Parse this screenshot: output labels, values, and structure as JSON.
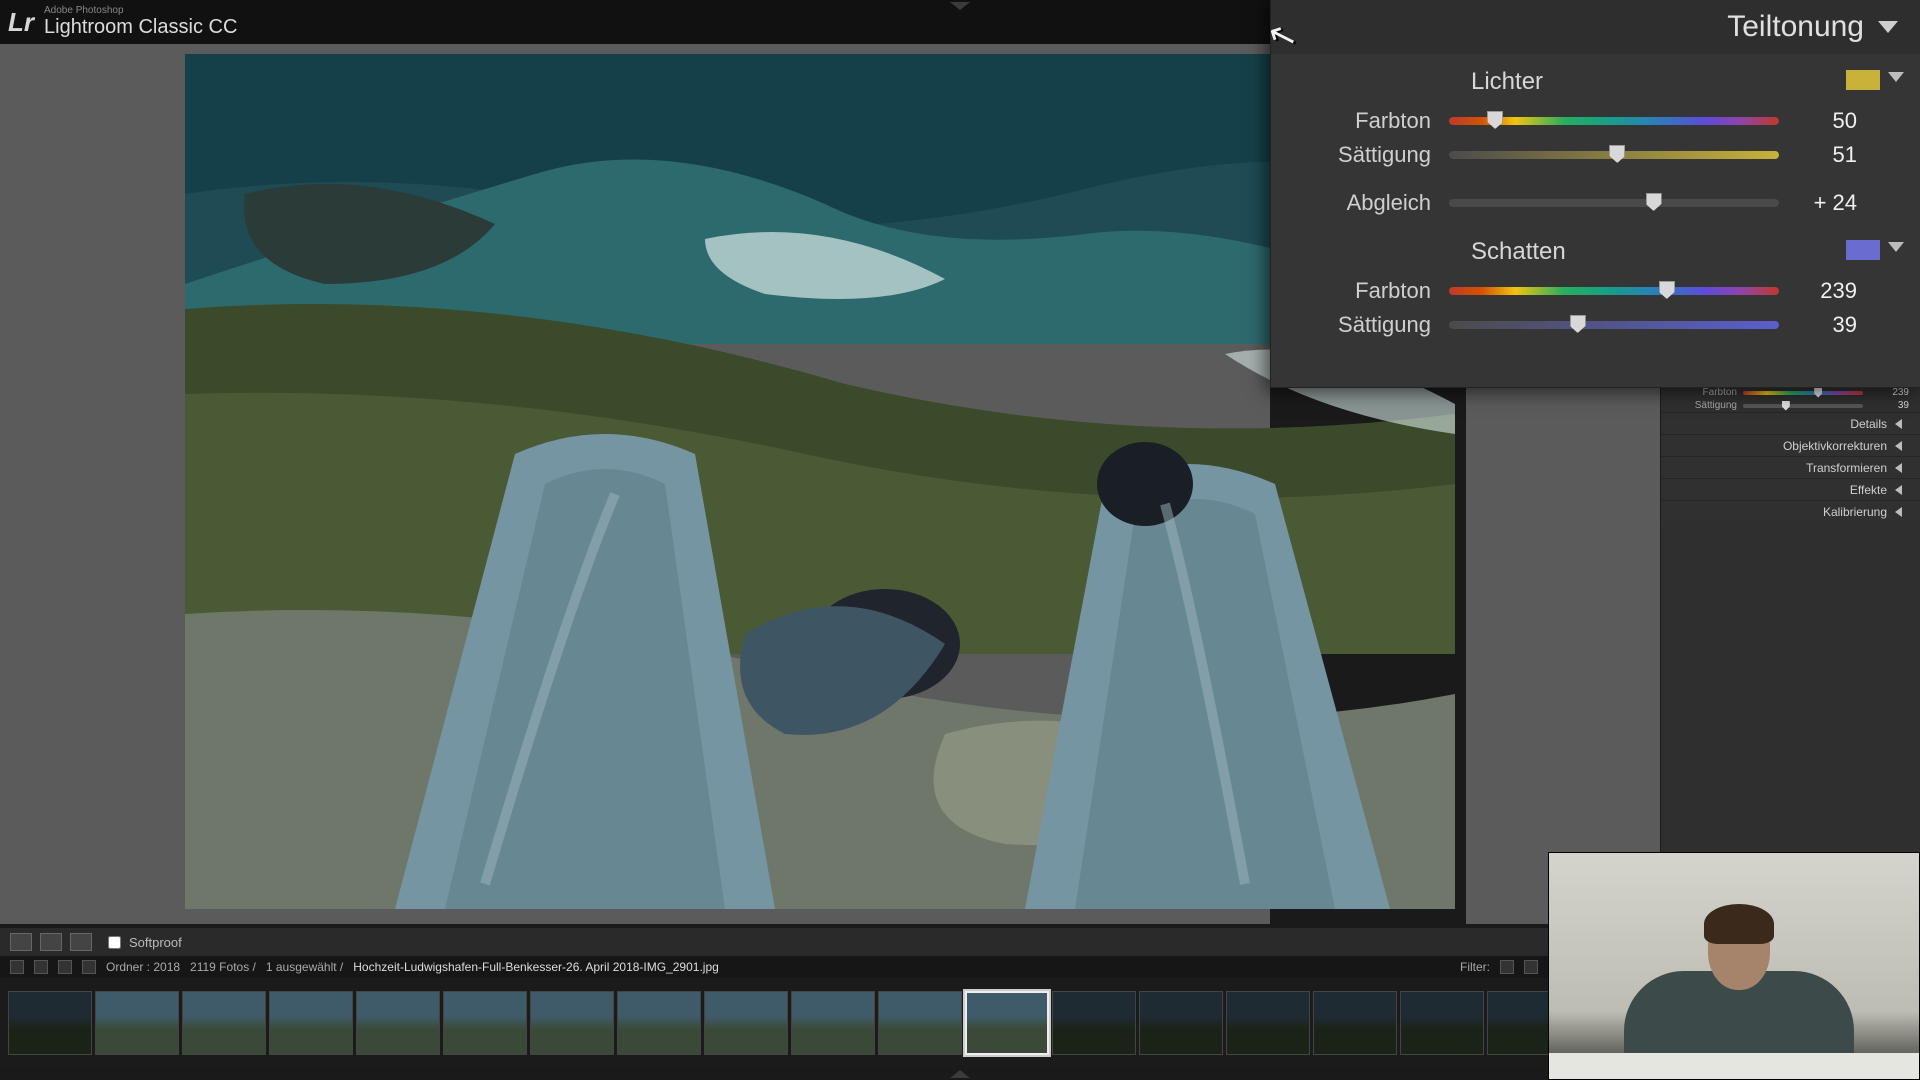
{
  "app": {
    "vendor": "Adobe Photoshop",
    "name": "Lightroom Classic CC",
    "mark": "Lr"
  },
  "panel": {
    "title": "Teiltonung",
    "lichter": {
      "title": "Lichter",
      "swatch_color": "#c8b23a",
      "farbton": {
        "label": "Farbton",
        "value": "50",
        "pct": 14
      },
      "saettigung": {
        "label": "Sättigung",
        "value": "51",
        "pct": 51
      }
    },
    "abgleich": {
      "label": "Abgleich",
      "value": "+ 24",
      "pct": 62
    },
    "schatten": {
      "title": "Schatten",
      "swatch_color": "#6a6cd0",
      "farbton": {
        "label": "Farbton",
        "value": "239",
        "pct": 66
      },
      "saettigung": {
        "label": "Sättigung",
        "value": "39",
        "pct": 39
      }
    }
  },
  "mini_panel": {
    "farbton": {
      "label": "Farbton",
      "value": "239",
      "pct": 66
    },
    "saettigung": {
      "label": "Sättigung",
      "value": "39",
      "pct": 39
    },
    "sections": [
      {
        "name": "Details"
      },
      {
        "name": "Objektivkorrekturen"
      },
      {
        "name": "Transformieren"
      },
      {
        "name": "Effekte"
      },
      {
        "name": "Kalibrierung"
      }
    ]
  },
  "toolbar": {
    "softproof": "Softproof"
  },
  "breadcrumb": {
    "folder": "Ordner : 2018",
    "count": "2119 Fotos /",
    "selected": "1 ausgewählt /",
    "filename": "Hochzeit-Ludwigshafen-Full-Benkesser-26. April 2018-IMG_2901.jpg",
    "filter_label": "Filter:"
  },
  "filmstrip": {
    "thumbs": [
      {
        "variant": "dark"
      },
      {
        "variant": ""
      },
      {
        "variant": ""
      },
      {
        "variant": ""
      },
      {
        "variant": ""
      },
      {
        "variant": ""
      },
      {
        "variant": ""
      },
      {
        "variant": ""
      },
      {
        "variant": ""
      },
      {
        "variant": ""
      },
      {
        "variant": ""
      },
      {
        "variant": "selected"
      },
      {
        "variant": "dark"
      },
      {
        "variant": "dark"
      },
      {
        "variant": "dark"
      },
      {
        "variant": "dark"
      },
      {
        "variant": "dark"
      },
      {
        "variant": "dark"
      },
      {
        "variant": "dark"
      }
    ]
  }
}
